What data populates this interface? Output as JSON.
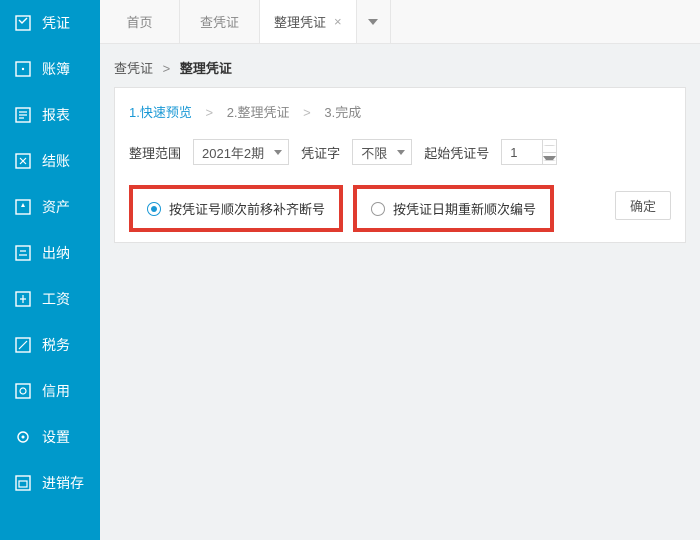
{
  "sidebar": {
    "items": [
      {
        "label": "凭证",
        "icon": "voucher-icon"
      },
      {
        "label": "账簿",
        "icon": "ledger-icon"
      },
      {
        "label": "报表",
        "icon": "report-icon"
      },
      {
        "label": "结账",
        "icon": "close-period-icon"
      },
      {
        "label": "资产",
        "icon": "asset-icon"
      },
      {
        "label": "出纳",
        "icon": "cashier-icon"
      },
      {
        "label": "工资",
        "icon": "salary-icon"
      },
      {
        "label": "税务",
        "icon": "tax-icon"
      },
      {
        "label": "信用",
        "icon": "credit-icon"
      },
      {
        "label": "设置",
        "icon": "settings-icon"
      },
      {
        "label": "进销存",
        "icon": "inventory-icon"
      }
    ]
  },
  "tabs": [
    {
      "label": "首页",
      "active": false,
      "closable": false
    },
    {
      "label": "查凭证",
      "active": false,
      "closable": false
    },
    {
      "label": "整理凭证",
      "active": true,
      "closable": true
    }
  ],
  "breadcrumb": {
    "a": "查凭证",
    "b": "整理凭证"
  },
  "steps": {
    "s1": "1.快速预览",
    "s2": "2.整理凭证",
    "s3": "3.完成"
  },
  "filters": {
    "range_label": "整理范围",
    "range_value": "2021年2期",
    "type_label": "凭证字",
    "type_value": "不限",
    "startno_label": "起始凭证号",
    "startno_value": "1"
  },
  "options": {
    "opt1": "按凭证号顺次前移补齐断号",
    "opt2": "按凭证日期重新顺次编号",
    "selected": 0
  },
  "buttons": {
    "ok": "确定"
  }
}
